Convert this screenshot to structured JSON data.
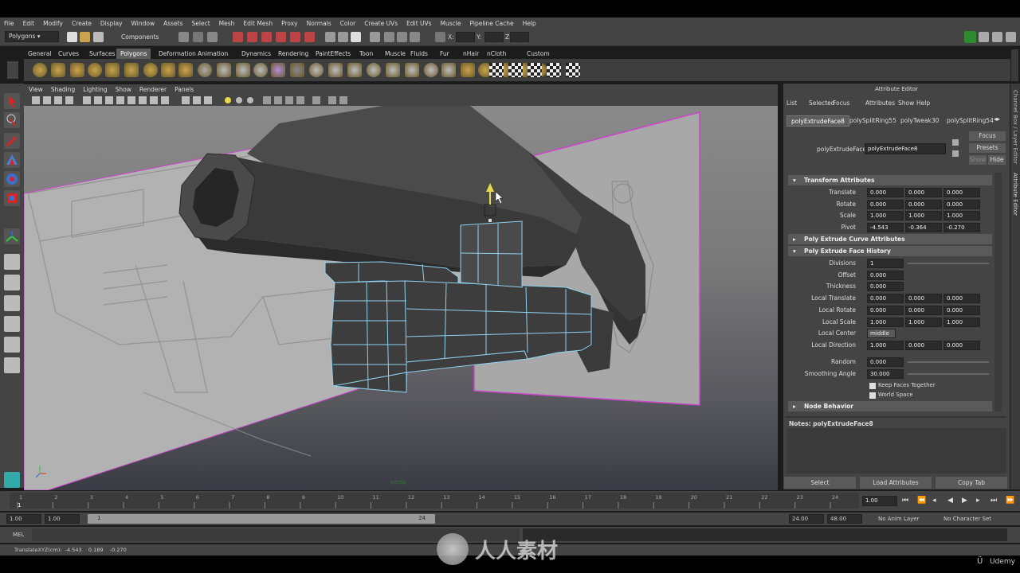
{
  "menubar": [
    "File",
    "Edit",
    "Modify",
    "Create",
    "Display",
    "Window",
    "Assets",
    "Select",
    "Mesh",
    "Edit Mesh",
    "Proxy",
    "Normals",
    "Color",
    "Create UVs",
    "Edit UVs",
    "Muscle",
    "Pipeline Cache",
    "Help"
  ],
  "status_line": {
    "mode": "Polygons",
    "components_label": "Components",
    "x_label": "X:",
    "y_label": "Y:",
    "z_label": "Z:"
  },
  "shelf_tabs": [
    "General",
    "Curves",
    "Surfaces",
    "Polygons",
    "Deformation",
    "Animation",
    "Dynamics",
    "Rendering",
    "PaintEffects",
    "Toon",
    "Muscle",
    "Fluids",
    "Fur",
    "nHair",
    "nCloth",
    "Custom"
  ],
  "shelf_active_tab": "Polygons",
  "viewport": {
    "menu": [
      "View",
      "Shading",
      "Lighting",
      "Show",
      "Renderer",
      "Panels"
    ],
    "camera_label": "persp"
  },
  "attribute_editor": {
    "title": "Attribute Editor",
    "menu": [
      "List",
      "Selected",
      "Focus",
      "Attributes",
      "Show",
      "Help"
    ],
    "tabs": [
      "polyExtrudeFace8",
      "polySplitRing55",
      "polyTweak30",
      "polySplitRing54"
    ],
    "node_label": "polyExtrudeFace:",
    "node_name": "polyExtrudeFace8",
    "side_buttons": {
      "focus": "Focus",
      "presets": "Presets",
      "show": "Show",
      "hide": "Hide"
    },
    "sections": {
      "transform": "Transform Attributes",
      "curve": "Poly Extrude Curve Attributes",
      "history": "Poly Extrude Face History",
      "node": "Node Behavior"
    },
    "transform_rows": [
      {
        "label": "Translate",
        "values": [
          "0.000",
          "0.000",
          "0.000"
        ]
      },
      {
        "label": "Rotate",
        "values": [
          "0.000",
          "0.000",
          "0.000"
        ]
      },
      {
        "label": "Scale",
        "values": [
          "1.000",
          "1.000",
          "1.000"
        ]
      },
      {
        "label": "Pivot",
        "values": [
          "-4.543",
          "-0.364",
          "-0.270"
        ]
      }
    ],
    "history_rows": [
      {
        "label": "Divisions",
        "values": [
          "1"
        ]
      },
      {
        "label": "Offset",
        "values": [
          "0.000"
        ]
      },
      {
        "label": "Thickness",
        "values": [
          "0.000"
        ]
      },
      {
        "label": "Local Translate",
        "values": [
          "0.000",
          "0.000",
          "0.000"
        ]
      },
      {
        "label": "Local Rotate",
        "values": [
          "0.000",
          "0.000",
          "0.000"
        ]
      },
      {
        "label": "Local Scale",
        "values": [
          "1.000",
          "1.000",
          "1.000"
        ]
      },
      {
        "label": "Local Center",
        "values": [
          "middle"
        ]
      },
      {
        "label": "Local Direction",
        "values": [
          "1.000",
          "0.000",
          "0.000"
        ]
      }
    ],
    "random": {
      "label": "Random",
      "value": "0.000"
    },
    "smoothing": {
      "label": "Smoothing Angle",
      "value": "30.000"
    },
    "keep_faces": "Keep Faces Together",
    "world_space": "World Space",
    "notes": "Notes: polyExtrudeFace8",
    "bottom_buttons": [
      "Select",
      "Load Attributes",
      "Copy Tab"
    ]
  },
  "right_strip": [
    "Channel Box / Layer Editor",
    "Attribute Editor"
  ],
  "time_slider": {
    "ticks": [
      "1",
      "2",
      "3",
      "4",
      "5",
      "6",
      "7",
      "8",
      "9",
      "10",
      "11",
      "12",
      "13",
      "14",
      "15",
      "16",
      "17",
      "18",
      "19",
      "20",
      "21",
      "22",
      "23",
      "24"
    ],
    "current": "1",
    "current_frame": "1.00"
  },
  "range_slider": {
    "start": "1.00",
    "start2": "1.00",
    "range_start": "1",
    "range_end": "24",
    "end": "24.00",
    "end2": "48.00",
    "anim_layer": "No Anim Layer",
    "char_set": "No Character Set"
  },
  "cmdline": {
    "label": "MEL"
  },
  "helpline": {
    "text": "TranslateXYZ(cm):  -4.543    0.189    -0.270"
  },
  "watermark": {
    "cn": "人人素材",
    "brand": "Udemy"
  },
  "colors": {
    "accent": "#5ec8e6",
    "wire": "#8fd3f0",
    "mag": "#cc44cc"
  }
}
